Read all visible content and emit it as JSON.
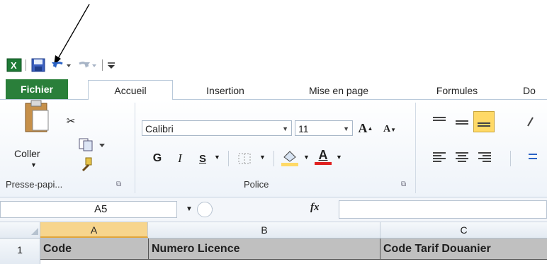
{
  "quick_access": {
    "excel_icon": "excel-icon",
    "save_icon": "save-icon",
    "undo_icon": "undo-icon",
    "redo_icon": "redo-icon",
    "customize_icon": "customize-qat-icon"
  },
  "tabs": [
    {
      "label": "Fichier"
    },
    {
      "label": "Accueil"
    },
    {
      "label": "Insertion"
    },
    {
      "label": "Mise en page"
    },
    {
      "label": "Formules"
    },
    {
      "label": "Do"
    }
  ],
  "ribbon": {
    "clipboard": {
      "paste_label": "Coller",
      "group_label": "Presse-papi..."
    },
    "font": {
      "font_name": "Calibri",
      "font_size": "11",
      "bold": "G",
      "italic": "I",
      "underline": "S",
      "grow": "A",
      "shrink": "A",
      "font_color_letter": "A",
      "group_label": "Police"
    }
  },
  "formula_bar": {
    "name_box": "A5",
    "fx": "fx",
    "formula": ""
  },
  "sheet": {
    "columns": [
      "A",
      "B",
      "C"
    ],
    "rows": [
      {
        "num": "1",
        "cells": [
          "Code",
          "Numero Licence",
          "Code Tarif Douanier"
        ]
      }
    ]
  },
  "colors": {
    "file_tab": "#2a7f3a",
    "highlight": "#ffd966",
    "font_red": "#e02020",
    "header_fill": "#c0c0c0",
    "selected_col": "#f7d58d"
  }
}
